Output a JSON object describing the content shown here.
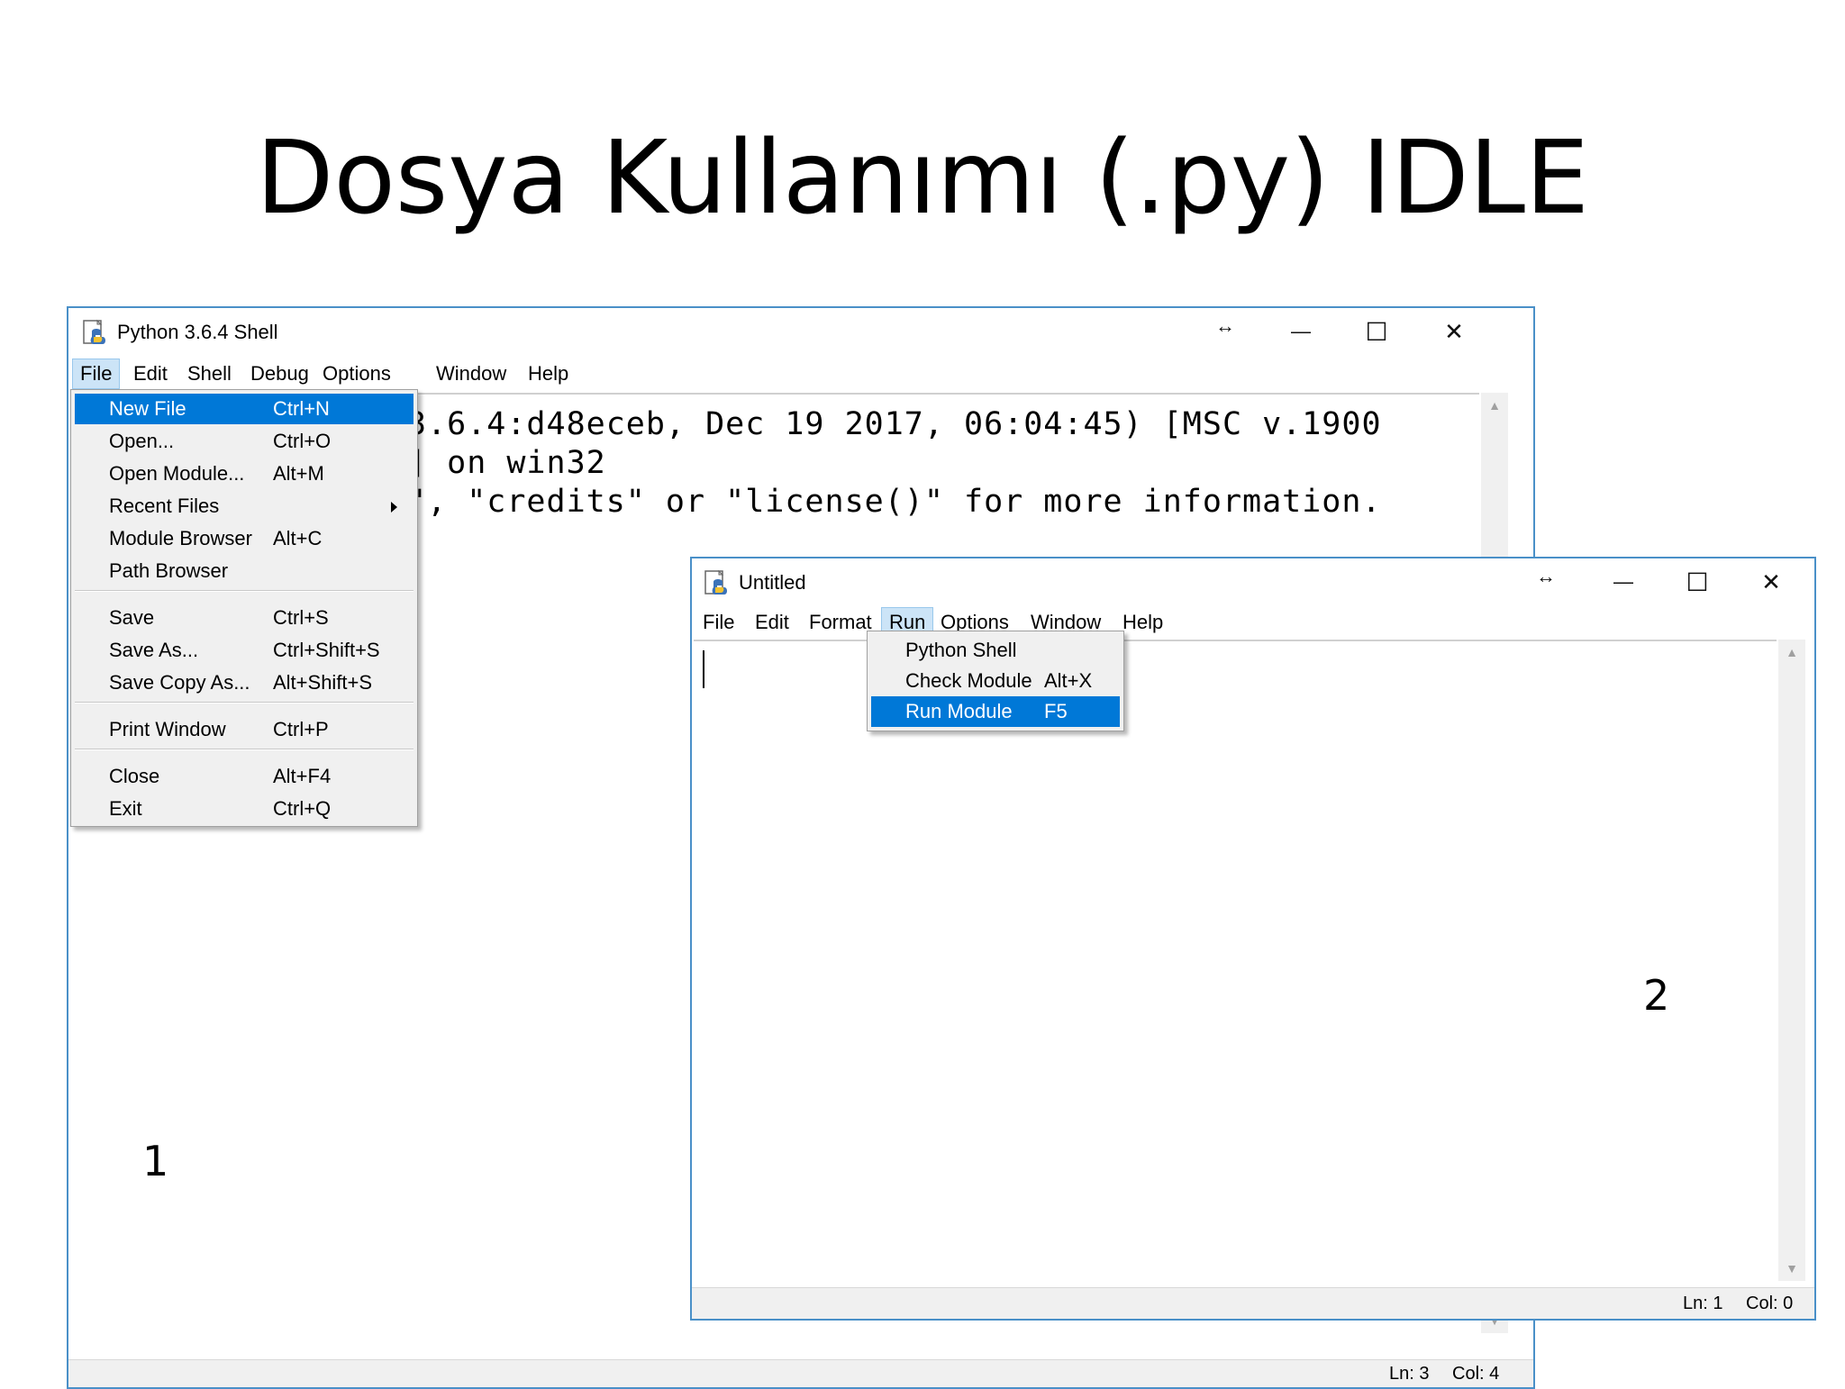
{
  "slide": {
    "title": "Dosya Kullanımı (.py) IDLE",
    "label_1": "1",
    "label_2": "2"
  },
  "shell_window": {
    "title": "Python 3.6.4 Shell",
    "title_icon": "python-idle-icon",
    "resize_glyph": "↔",
    "minimize_glyph": "—",
    "maximize_glyph": "☐",
    "close_glyph": "✕",
    "menu": [
      "File",
      "Edit",
      "Shell",
      "Debug",
      "Options",
      "Window",
      "Help"
    ],
    "active_menu": "File",
    "text_lines": [
      "3.6.4:d48eceb, Dec 19 2017, 06:04:45) [MSC v.1900",
      "] on win32",
      "\", \"credits\" or \"license()\" for more information."
    ],
    "status": {
      "line": "Ln: 3",
      "col": "Col: 4"
    },
    "file_menu": {
      "items": [
        {
          "label": "New File",
          "accel": "Ctrl+N",
          "highlight": true
        },
        {
          "label": "Open...",
          "accel": "Ctrl+O"
        },
        {
          "label": "Open Module...",
          "accel": "Alt+M"
        },
        {
          "label": "Recent Files",
          "accel": "",
          "submenu": true
        },
        {
          "label": "Module Browser",
          "accel": "Alt+C"
        },
        {
          "label": "Path Browser",
          "accel": ""
        },
        {
          "label": "Save",
          "accel": "Ctrl+S"
        },
        {
          "label": "Save As...",
          "accel": "Ctrl+Shift+S"
        },
        {
          "label": "Save Copy As...",
          "accel": "Alt+Shift+S"
        },
        {
          "label": "Print Window",
          "accel": "Ctrl+P"
        },
        {
          "label": "Close",
          "accel": "Alt+F4"
        },
        {
          "label": "Exit",
          "accel": "Ctrl+Q"
        }
      ]
    }
  },
  "editor_window": {
    "title": "Untitled",
    "title_icon": "python-idle-icon",
    "resize_glyph": "↔",
    "minimize_glyph": "—",
    "maximize_glyph": "☐",
    "close_glyph": "✕",
    "menu": [
      "File",
      "Edit",
      "Format",
      "Run",
      "Options",
      "Window",
      "Help"
    ],
    "active_menu": "Run",
    "status": {
      "line": "Ln: 1",
      "col": "Col: 0"
    },
    "run_menu": {
      "items": [
        {
          "label": "Python Shell",
          "accel": ""
        },
        {
          "label": "Check Module",
          "accel": "Alt+X"
        },
        {
          "label": "Run Module",
          "accel": "F5",
          "highlight": true
        }
      ]
    }
  },
  "colors": {
    "window_border": "#4a90c8",
    "menu_highlight": "#0078d7",
    "active_menu_bg": "#cce4f7"
  }
}
